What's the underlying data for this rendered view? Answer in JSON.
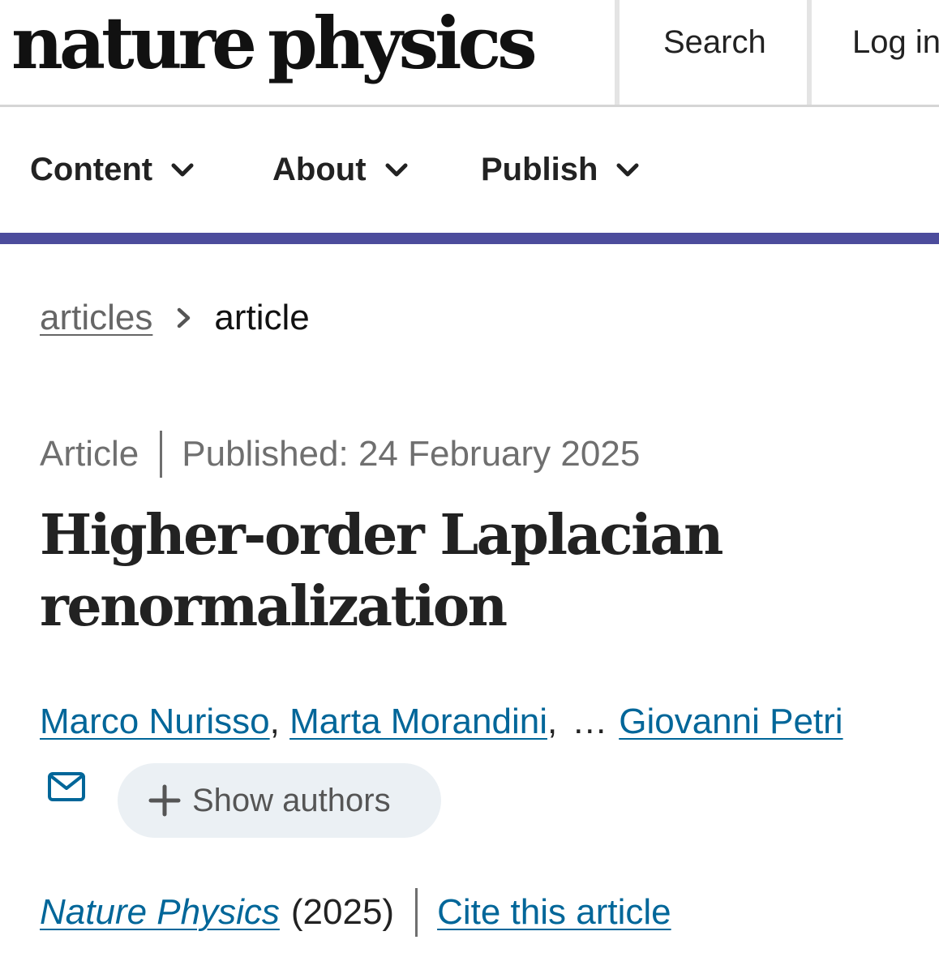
{
  "header": {
    "logo_part1": "nature",
    "logo_part2": "physics",
    "search_label": "Search",
    "login_label": "Log in"
  },
  "nav": {
    "items": [
      {
        "label": "Content",
        "icon": "chevron-down-icon"
      },
      {
        "label": "About",
        "icon": "chevron-down-icon"
      },
      {
        "label": "Publish",
        "icon": "chevron-down-icon"
      }
    ],
    "accent_color": "#4c4c9c"
  },
  "breadcrumb": {
    "parent": "articles",
    "current": "article"
  },
  "meta": {
    "type": "Article",
    "published": "Published: 24 February 2025"
  },
  "article": {
    "title_line1": "Higher-order Laplacian",
    "title_line2": "renormalization"
  },
  "authors": {
    "list": [
      "Marco Nurisso",
      "Marta Morandini",
      "Giovanni Petri"
    ],
    "ellipsis": "…",
    "show_authors_label": "Show authors",
    "link_color": "#006699"
  },
  "journal": {
    "name": "Nature Physics",
    "year": "(2025)",
    "cite_label": "Cite this article"
  }
}
